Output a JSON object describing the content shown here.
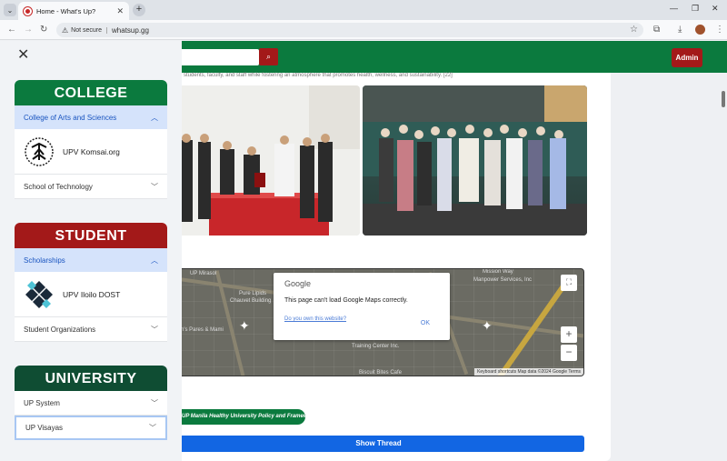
{
  "browser": {
    "tab_title": "Home - What's Up?",
    "url_security": "Not secure",
    "url": "whatsup.gg"
  },
  "header": {
    "admin_label": "Admin"
  },
  "main": {
    "blurb": "students, faculty, and staff while fostering an atmosphere that promotes health, wellness, and sustainability. [22]",
    "map": {
      "dialog_logo": "Google",
      "dialog_message": "This page can't load Google Maps correctly.",
      "dialog_link": "Do you own this website?",
      "dialog_ok": "OK",
      "labels": [
        "Mission Way",
        "Manpower Services, Inc",
        "Pure Lipids",
        "Chauvet Building",
        "Training Center Inc.",
        "Biscuit Bites Cafe",
        "Lion's Pares & Mami",
        "UP Mirasol"
      ],
      "footer": "Keyboard shortcuts   Map data ©2024 Google   Terms"
    },
    "tag_pill": "UP Manila Healthy University Policy and Framework",
    "show_thread": "Show Thread"
  },
  "sidebar": {
    "college": {
      "heading": "COLLEGE",
      "open_item": "College of Arts and Sciences",
      "org_name": "UPV Komsai.org",
      "collapsed_items": [
        "School of Technology"
      ]
    },
    "student": {
      "heading": "STUDENT",
      "open_item": "Scholarships",
      "org_name": "UPV Iloilo DOST",
      "collapsed_items": [
        "Student Organizations"
      ]
    },
    "university": {
      "heading": "UNIVERSITY",
      "collapsed_items": [
        "UP System",
        "UP Visayas"
      ]
    }
  },
  "colors": {
    "green": "#0b7a3e",
    "maroon": "#a31919",
    "dark_green": "#0f4d33",
    "blue": "#1266e3",
    "open_row": "#d5e3fb"
  }
}
